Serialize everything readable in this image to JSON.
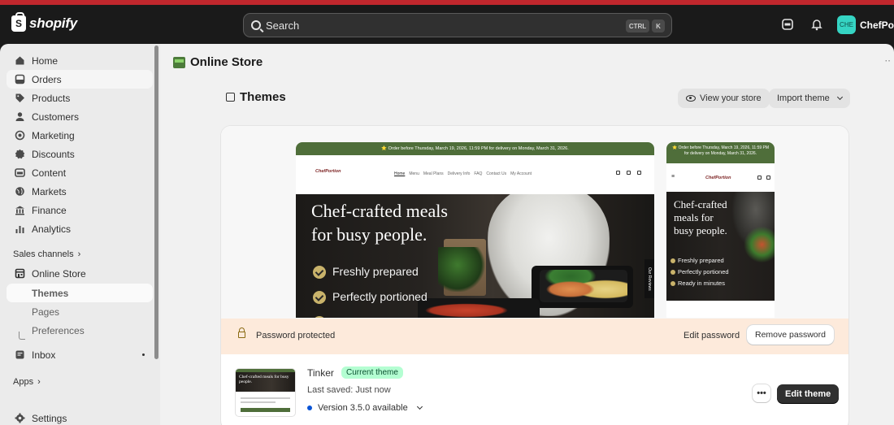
{
  "topbar": {
    "logo_text": "shopify",
    "search_placeholder": "Search",
    "kbd_ctrl": "CTRL",
    "kbd_k": "K",
    "avatar_initials": "CHE",
    "store_name": "ChefPorti"
  },
  "sidebar": {
    "items": [
      {
        "label": "Home",
        "icon": "home-icon"
      },
      {
        "label": "Orders",
        "icon": "orders-icon"
      },
      {
        "label": "Products",
        "icon": "tag-icon"
      },
      {
        "label": "Customers",
        "icon": "person-icon"
      },
      {
        "label": "Marketing",
        "icon": "megaphone-icon"
      },
      {
        "label": "Discounts",
        "icon": "discount-icon"
      },
      {
        "label": "Content",
        "icon": "content-icon"
      },
      {
        "label": "Markets",
        "icon": "globe-icon"
      },
      {
        "label": "Finance",
        "icon": "bank-icon"
      },
      {
        "label": "Analytics",
        "icon": "chart-icon"
      }
    ],
    "sales_channels_label": "Sales channels",
    "online_store_label": "Online Store",
    "sub_items": [
      "Themes",
      "Pages",
      "Preferences"
    ],
    "inbox_label": "Inbox",
    "apps_label": "Apps",
    "settings_label": "Settings"
  },
  "main": {
    "page_title": "Online Store",
    "section_title": "Themes",
    "view_store_label": "View your store",
    "import_theme_label": "Import theme",
    "preview": {
      "announcement": "⭐ Order before Thursday, March 19, 2026, 11:59 PM for delivery on Monday, March 31, 2026.",
      "mobile_announcement": "⭐ Order before Thursday, March 19, 2026, 11:59 PM for delivery on Monday, March 31, 2026.",
      "logo": "ChefPortion",
      "nav_links": [
        "Home",
        "Menu",
        "Meal Plans",
        "Delivery Info",
        "FAQ",
        "Contact Us",
        "My Account"
      ],
      "headline_line1": "Chef-crafted meals",
      "headline_line2": "for busy people.",
      "mobile_headline": [
        "Chef-crafted",
        "meals for",
        "busy people."
      ],
      "benefits": [
        "Freshly prepared",
        "Perfectly portioned",
        "Ready in minutes"
      ],
      "reviews_tab": "Our Reviews"
    },
    "password_bar": {
      "text": "Password protected",
      "edit_label": "Edit password",
      "remove_label": "Remove password"
    },
    "theme": {
      "name": "Tinker",
      "badge": "Current theme",
      "last_saved": "Last saved: Just now",
      "version": "Version 3.5.0 available",
      "more_label": "•••",
      "edit_label": "Edit theme",
      "thumb_headline": "Chef-crafted meals for busy people."
    }
  },
  "colors": {
    "topbar_bg": "#1a1a1a",
    "brand_green": "#4f6e3a",
    "badge_bg": "#b4fed2",
    "password_bar_bg": "#fdeadb",
    "primary_button": "#303030"
  }
}
